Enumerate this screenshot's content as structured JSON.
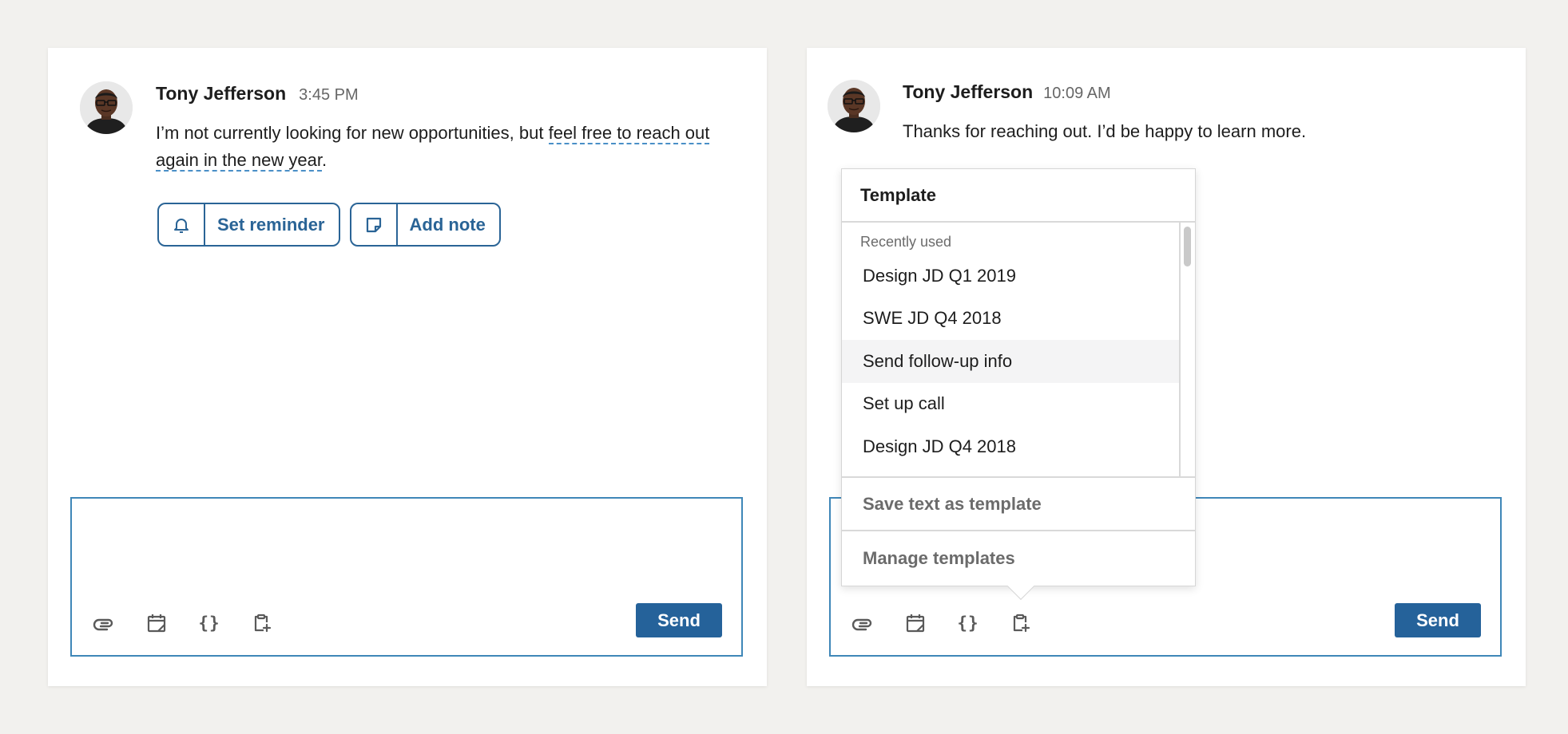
{
  "panels": [
    {
      "sender": "Tony Jefferson",
      "time": "3:45 PM",
      "message_prefix": "I’m not currently looking for new opportunities, but ",
      "message_highlight": "feel free to reach out again in the new year",
      "message_suffix": ".",
      "actions": [
        {
          "label": "Set reminder",
          "icon": "bell-icon"
        },
        {
          "label": "Add note",
          "icon": "note-icon"
        }
      ],
      "send_label": "Send"
    },
    {
      "sender": "Tony Jefferson",
      "time": "10:09 AM",
      "message": "Thanks for reaching out. I’d be happy to learn more.",
      "send_label": "Send"
    }
  ],
  "toolbar_icons": [
    "paperclip-icon",
    "calendar-icon",
    "braces-icon",
    "clipboard-plus-icon"
  ],
  "braces_glyph": "{}",
  "template_menu": {
    "title": "Template",
    "section_label": "Recently used",
    "items": [
      "Design JD Q1 2019",
      "SWE JD Q4 2018",
      "Send follow-up info",
      "Set up call",
      "Design JD Q4 2018"
    ],
    "hovered_item": "Send follow-up info",
    "save_label": "Save text as template",
    "manage_label": "Manage templates"
  },
  "colors": {
    "accent": "#25629a",
    "link": "#2a6496",
    "border_focus": "#3f87b8",
    "background": "#f2f1ee"
  }
}
